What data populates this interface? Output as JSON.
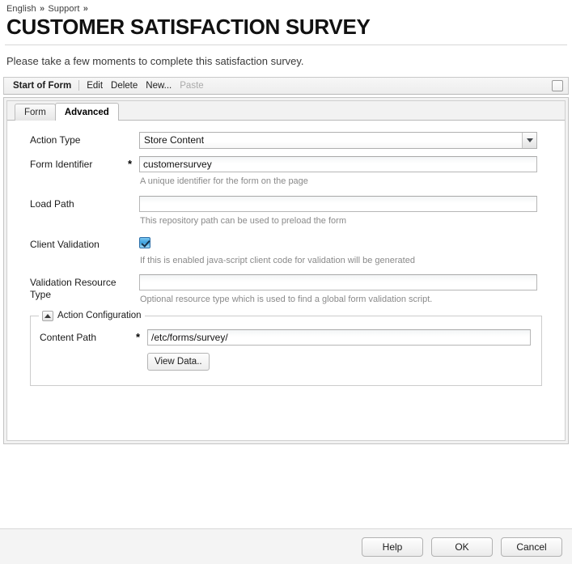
{
  "breadcrumb": {
    "items": [
      "English",
      "Support"
    ],
    "separator": "»"
  },
  "page": {
    "title": "CUSTOMER SATISFACTION SURVEY",
    "intro": "Please take a few moments to complete this satisfaction survey."
  },
  "toolbar": {
    "start_of_form": "Start of Form",
    "edit": "Edit",
    "delete": "Delete",
    "new": "New...",
    "paste": "Paste",
    "checkbox_checked": false
  },
  "tabs": [
    {
      "label": "Form",
      "active": false
    },
    {
      "label": "Advanced",
      "active": true
    }
  ],
  "form": {
    "action_type": {
      "label": "Action Type",
      "value": "Store Content",
      "options": [
        "Store Content"
      ]
    },
    "form_identifier": {
      "label": "Form Identifier",
      "required": "*",
      "value": "customersurvey",
      "help": "A unique identifier for the form on the page"
    },
    "load_path": {
      "label": "Load Path",
      "value": "",
      "placeholder": "",
      "help": "This repository path can be used to preload the form"
    },
    "client_validation": {
      "label": "Client Validation",
      "checked": true,
      "help": "If this is enabled java-script client code for validation will be generated"
    },
    "validation_resource_type": {
      "label": "Validation Resource Type",
      "value": "",
      "placeholder": "",
      "help": "Optional resource type which is used to find a global form validation script."
    }
  },
  "action_configuration": {
    "legend": "Action Configuration",
    "collapse_icon": "caret-up-icon",
    "content_path": {
      "label": "Content Path",
      "required": "*",
      "value": "/etc/forms/survey/"
    },
    "view_data_button": "View Data.."
  },
  "footer": {
    "help": "Help",
    "ok": "OK",
    "cancel": "Cancel"
  },
  "colors": {
    "checkbox_accent": "#3fa3e0",
    "panel_bg": "#f2f2f2",
    "help_text": "#8a8a8a"
  }
}
